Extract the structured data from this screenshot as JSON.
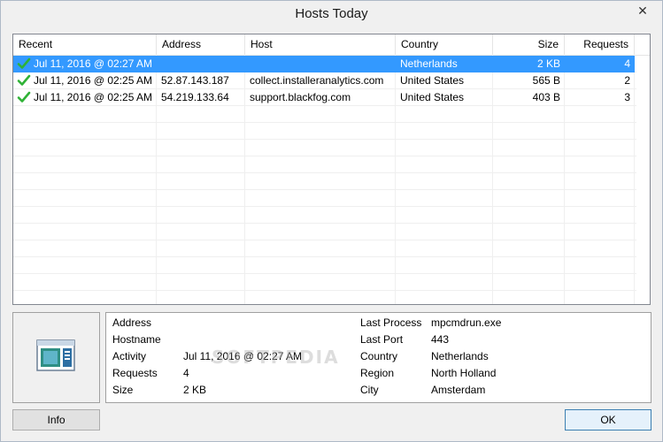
{
  "window": {
    "title": "Hosts Today",
    "close_glyph": "✕"
  },
  "list": {
    "columns": [
      "Recent",
      "Address",
      "Host",
      "Country",
      "Size",
      "Requests"
    ],
    "rows": [
      {
        "recent": "Jul 11, 2016 @ 02:27 AM",
        "address": "",
        "host": "",
        "country": "Netherlands",
        "size": "2 KB",
        "requests": "4",
        "selected": true,
        "icon": "green-check-icon"
      },
      {
        "recent": "Jul 11, 2016 @ 02:25 AM",
        "address": "52.87.143.187",
        "host": "collect.installeranalytics.com",
        "country": "United States",
        "size": "565 B",
        "requests": "2",
        "selected": false,
        "icon": "green-check-icon"
      },
      {
        "recent": "Jul 11, 2016 @ 02:25 AM",
        "address": "54.219.133.64",
        "host": "support.blackfog.com",
        "country": "United States",
        "size": "403 B",
        "requests": "3",
        "selected": false,
        "icon": "green-check-icon"
      }
    ]
  },
  "details": {
    "address_label": "Address",
    "address_value": "",
    "hostname_label": "Hostname",
    "hostname_value": "",
    "activity_label": "Activity",
    "activity_value": "Jul 11, 2016 @ 02:27 AM",
    "requests_label": "Requests",
    "requests_value": "4",
    "size_label": "Size",
    "size_value": "2 KB",
    "last_process_label": "Last Process",
    "last_process_value": "mpcmdrun.exe",
    "last_port_label": "Last Port",
    "last_port_value": "443",
    "country_label": "Country",
    "country_value": "Netherlands",
    "region_label": "Region",
    "region_value": "North Holland",
    "city_label": "City",
    "city_value": "Amsterdam"
  },
  "watermark": "SOFTPEDIA",
  "buttons": {
    "info": "Info",
    "ok": "OK"
  },
  "colors": {
    "selection": "#3399ff",
    "check": "#2fb236"
  }
}
